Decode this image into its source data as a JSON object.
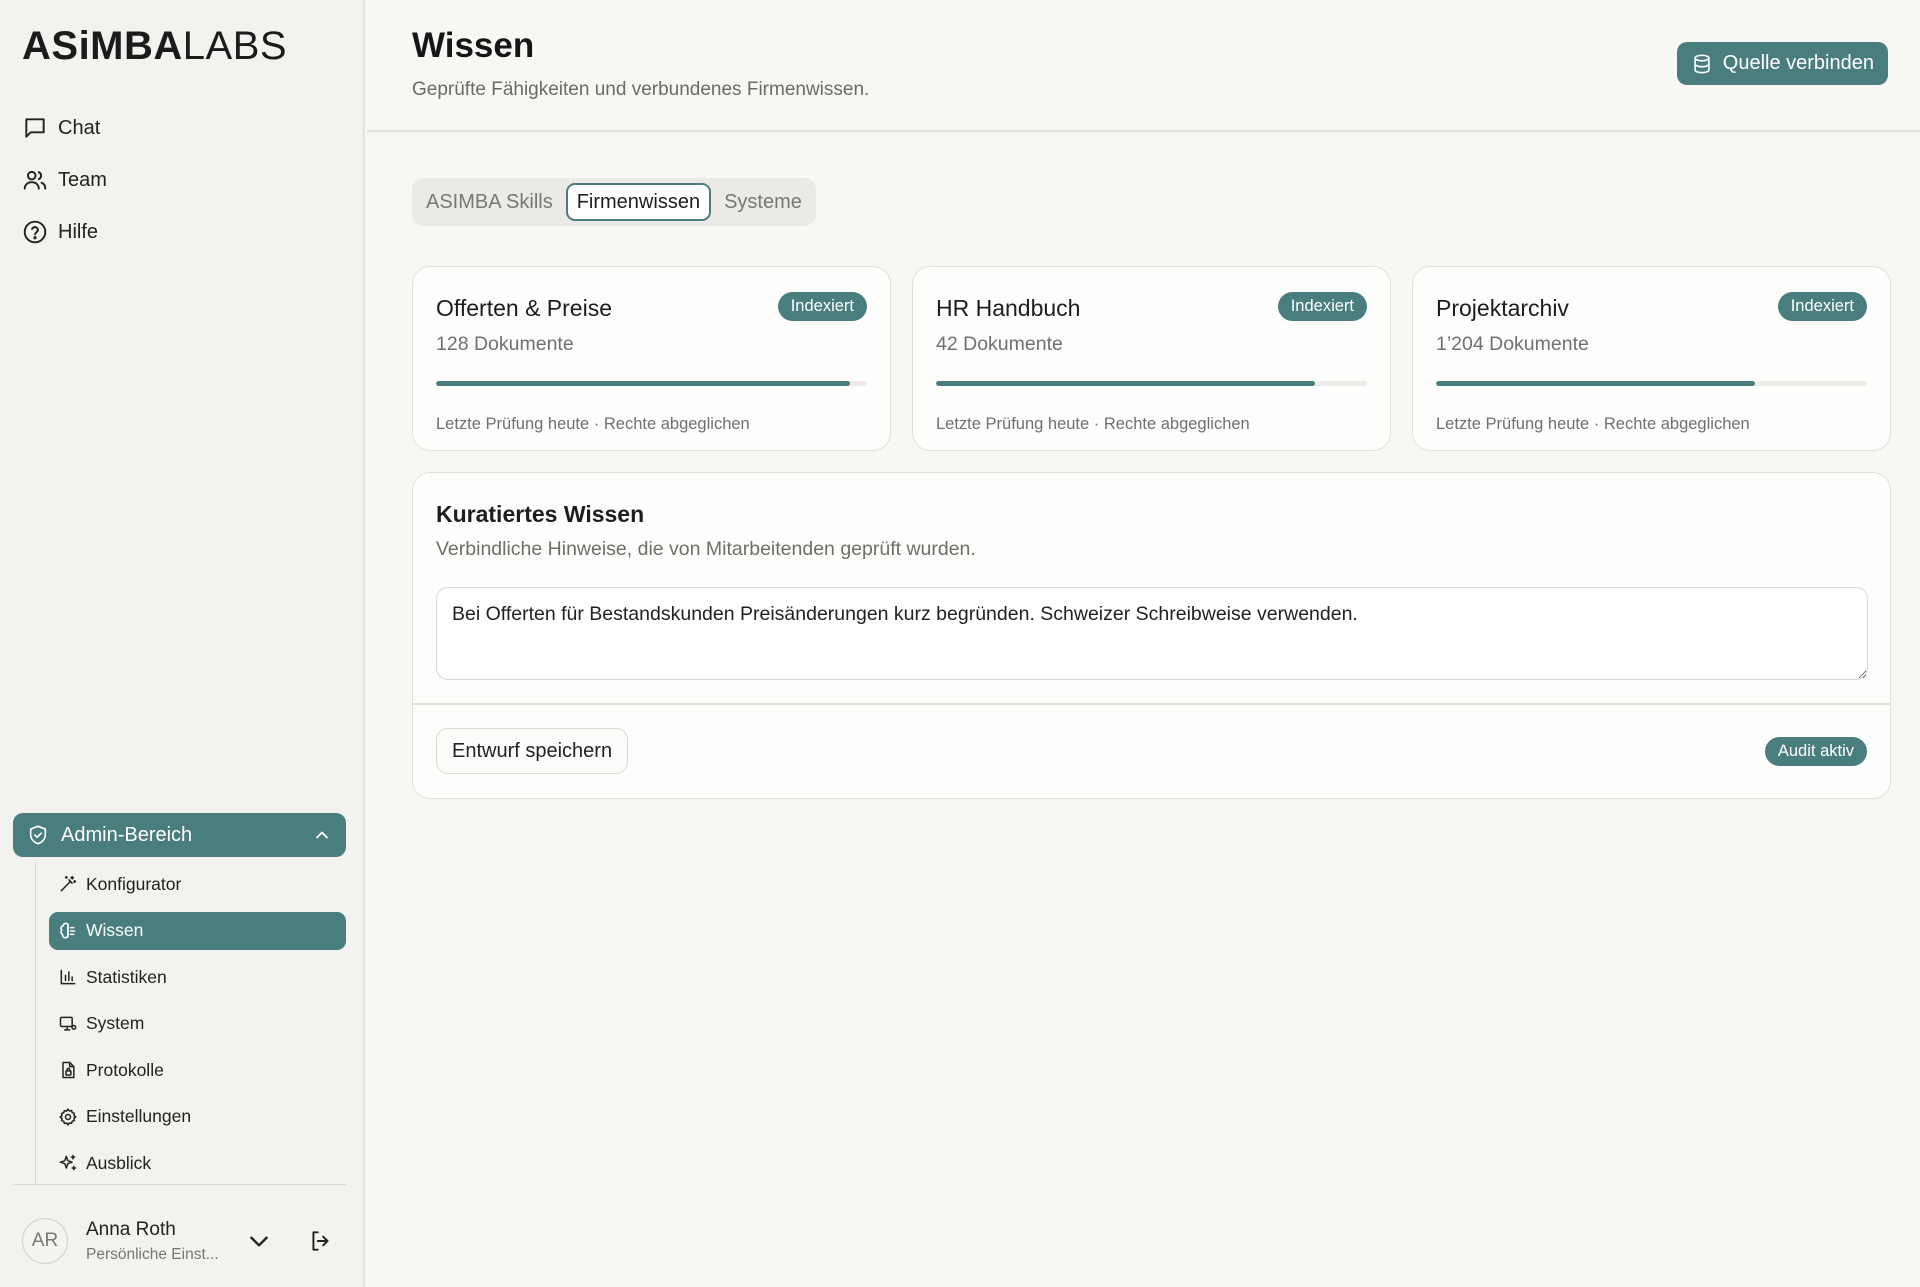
{
  "brand": {
    "logo_bold": "ASiMBA",
    "logo_light": "LABS"
  },
  "sidebar": {
    "nav": [
      {
        "label": "Chat",
        "icon": "message-square-icon"
      },
      {
        "label": "Team",
        "icon": "users-icon"
      },
      {
        "label": "Hilfe",
        "icon": "help-circle-icon"
      }
    ],
    "admin": {
      "label": "Admin-Bereich",
      "icon": "shield-icon",
      "items": [
        {
          "label": "Konfigurator",
          "icon": "wand-icon"
        },
        {
          "label": "Wissen",
          "icon": "brain-icon",
          "active": true
        },
        {
          "label": "Statistiken",
          "icon": "bar-chart-icon"
        },
        {
          "label": "System",
          "icon": "monitor-icon"
        },
        {
          "label": "Protokolle",
          "icon": "file-lock-icon"
        },
        {
          "label": "Einstellungen",
          "icon": "gear-icon"
        },
        {
          "label": "Ausblick",
          "icon": "sparkles-icon"
        }
      ]
    },
    "user": {
      "initials": "AR",
      "name": "Anna Roth",
      "subtitle": "Persönliche Einst..."
    }
  },
  "header": {
    "title": "Wissen",
    "subtitle": "Geprüfte Fähigkeiten und verbundenes Firmenwissen.",
    "connect_label": "Quelle verbinden"
  },
  "tabs": [
    {
      "label": "ASIMBA Skills",
      "active": false
    },
    {
      "label": "Firmenwissen",
      "active": true
    },
    {
      "label": "Systeme",
      "active": false
    }
  ],
  "sources": [
    {
      "title": "Offerten & Preise",
      "badge": "Indexiert",
      "count": "128 Dokumente",
      "progress": 0.96,
      "meta": "Letzte Prüfung heute · Rechte abgeglichen"
    },
    {
      "title": "HR Handbuch",
      "badge": "Indexiert",
      "count": "42 Dokumente",
      "progress": 0.88,
      "meta": "Letzte Prüfung heute · Rechte abgeglichen"
    },
    {
      "title": "Projektarchiv",
      "badge": "Indexiert",
      "count": "1’204 Dokumente",
      "progress": 0.74,
      "meta": "Letzte Prüfung heute · Rechte abgeglichen"
    }
  ],
  "curated": {
    "title": "Kuratiertes Wissen",
    "subtitle": "Verbindliche Hinweise, die von Mitarbeitenden geprüft wurden.",
    "text": "Bei Offerten für Bestandskunden Preisänderungen kurz begründen. Schweizer Schreibweise verwenden.",
    "save_label": "Entwurf speichern",
    "audit_label": "Audit aktiv"
  },
  "colors": {
    "accent": "#4a7d7d",
    "background": "#f8f7f4",
    "sidebar": "#f3f2ef"
  }
}
